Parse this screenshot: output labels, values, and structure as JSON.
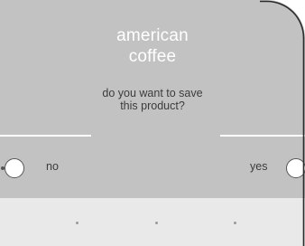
{
  "dialog": {
    "title_line1": "american",
    "title_line2": "coffee",
    "question_line1": "do you want to save",
    "question_line2": "this product?"
  },
  "actions": {
    "no_label": "no",
    "yes_label": "yes"
  },
  "page_indicator": {
    "dots": [
      "page-dot",
      "page-dot",
      "page-dot"
    ]
  },
  "colors": {
    "panel": "#c2c2c2",
    "footer": "#e9e9e9",
    "title_text": "#ffffff",
    "body_text": "#3c3c3c",
    "divider": "#ffffff"
  }
}
